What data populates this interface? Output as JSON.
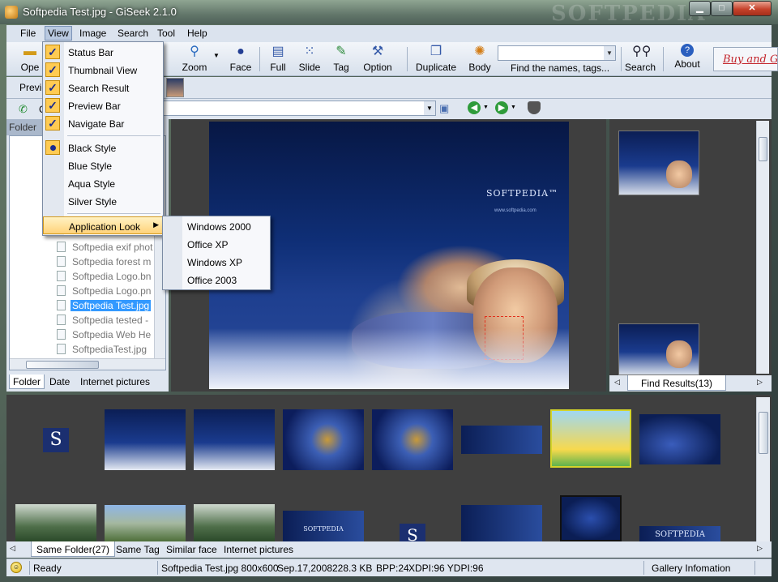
{
  "window": {
    "title": "Softpedia Test.jpg - GiSeek 2.1.0",
    "watermark": "SOFTPEDIA"
  },
  "menu": {
    "file": "File",
    "view": "View",
    "image": "Image",
    "search": "Search",
    "tool": "Tool",
    "help": "Help"
  },
  "toolbar": {
    "open": "Ope",
    "zoom": "Zoom",
    "face": "Face",
    "full": "Full",
    "slide": "Slide",
    "tag": "Tag",
    "option": "Option",
    "duplicate": "Duplicate",
    "body": "Body",
    "find_label": "Find the names, tags...",
    "search_value": "",
    "search": "Search",
    "about": "About",
    "buy": "Buy and G"
  },
  "preview_row": {
    "label": "Previe"
  },
  "address_row": {
    "prefix": "C",
    "value": ""
  },
  "view_menu": {
    "items": [
      {
        "label": "Status Bar",
        "checked": true
      },
      {
        "label": "Thumbnail View",
        "checked": true
      },
      {
        "label": "Search Result",
        "checked": true
      },
      {
        "label": "Preview Bar",
        "checked": true
      },
      {
        "label": "Navigate Bar",
        "checked": true
      }
    ],
    "styles": [
      {
        "label": "Black Style",
        "selected": true
      },
      {
        "label": "Blue Style",
        "selected": false
      },
      {
        "label": "Aqua Style",
        "selected": false
      },
      {
        "label": "Silver Style",
        "selected": false
      }
    ],
    "application_look": "Application Look"
  },
  "look_submenu": [
    "Windows 2000",
    "Office XP",
    "Windows XP",
    "Office 2003"
  ],
  "left_panel": {
    "header": "Folder",
    "files": [
      "Softpedia exif phot",
      "Softpedia forest m",
      "Softpedia Logo.bn",
      "Softpedia Logo.pn",
      "Softpedia Test.jpg",
      "Softpedia tested -",
      "Softpedia Web He",
      "SoftpediaTest.jpg"
    ],
    "selected_index": 4,
    "tabs": [
      "Folder",
      "Date",
      "Internet pictures"
    ]
  },
  "viewer": {
    "brand": "SOFTPEDIA™",
    "url": "www.softpedia.com"
  },
  "right_panel": {
    "tab": "Find Results(13)"
  },
  "gallery": {
    "tabs": [
      "Same Folder(27)",
      "Same Tag",
      "Similar face",
      "Internet pictures"
    ],
    "thumbs_row1": [
      "s-logo",
      "portrait",
      "portrait",
      "blue-s",
      "blue-s",
      "softpedia-banner",
      "colorful-card",
      "blue-abstract"
    ],
    "thumbs_row2": [
      "forest",
      "mountain",
      "forest",
      "softpedia-banner",
      "s-logo",
      "softpedia-banner",
      "dark-blue",
      "softpedia-banner"
    ],
    "banner_text": "SOFTPEDIA",
    "s_letter": "S"
  },
  "status": {
    "ready": "Ready",
    "file_info": "Softpedia Test.jpg 800x600",
    "date": "Sep.17,2008",
    "size": "228.3 KB",
    "bpp": "BPP:24",
    "dpi": "XDPI:96 YDPI:96",
    "gallery_info": "Gallery Infomation"
  },
  "icons": [
    "app-icon",
    "open-icon",
    "zoom-icon",
    "face-icon",
    "full-icon",
    "slide-icon",
    "tag-icon",
    "option-icon",
    "duplicate-icon",
    "body-icon",
    "search-icon",
    "about-icon",
    "phone-icon",
    "save-icon",
    "back-icon",
    "forward-icon",
    "shield-icon",
    "smile-icon"
  ]
}
